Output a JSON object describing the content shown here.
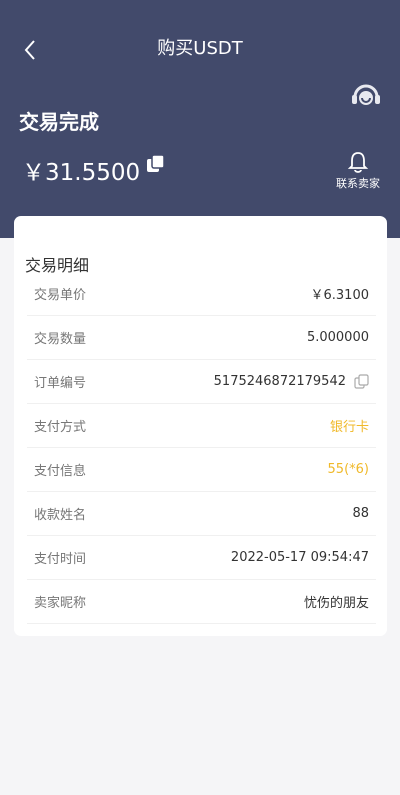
{
  "nav": {
    "title": "购买USDT"
  },
  "order": {
    "status": "交易完成",
    "amount": "￥31.5500",
    "contact_label": "联系卖家"
  },
  "details": {
    "title": "交易明细",
    "rows": [
      {
        "label": "交易单价",
        "value": "￥6.3100"
      },
      {
        "label": "交易数量",
        "value": "5.000000"
      },
      {
        "label": "订单编号",
        "value": "5175246872179542"
      },
      {
        "label": "支付方式",
        "value": "银行卡"
      },
      {
        "label": "支付信息",
        "value": "55(*6)"
      },
      {
        "label": "收款姓名",
        "value": "88"
      },
      {
        "label": "支付时间",
        "value": "2022-05-17 09:54:47"
      },
      {
        "label": "卖家昵称",
        "value": "忧伤的朋友"
      }
    ]
  },
  "colors": {
    "header_bg": "#424a6b",
    "accent": "#f0b92a"
  },
  "icons": [
    "back-arrow-icon",
    "headset-icon",
    "copy-icon",
    "bell-icon"
  ]
}
